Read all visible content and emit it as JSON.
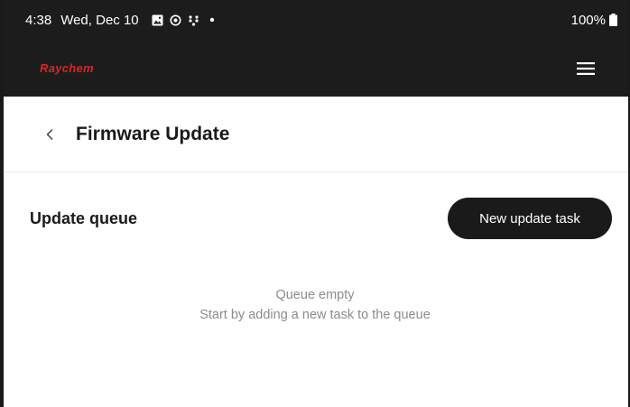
{
  "status_bar": {
    "time": "4:38",
    "date": "Wed, Dec 10",
    "battery": "100%",
    "icons": [
      "image-icon",
      "sync-icon",
      "dots-grid-icon",
      "dot-icon"
    ]
  },
  "header": {
    "brand": "Raychem",
    "brand_color": "#d6262b",
    "menu_icon": "hamburger-menu-icon"
  },
  "page": {
    "title": "Firmware Update",
    "back_icon": "chevron-left-icon"
  },
  "queue": {
    "title": "Update queue",
    "new_task_label": "New update task",
    "empty_title": "Queue empty",
    "empty_hint": "Start by adding a new task to the queue"
  }
}
